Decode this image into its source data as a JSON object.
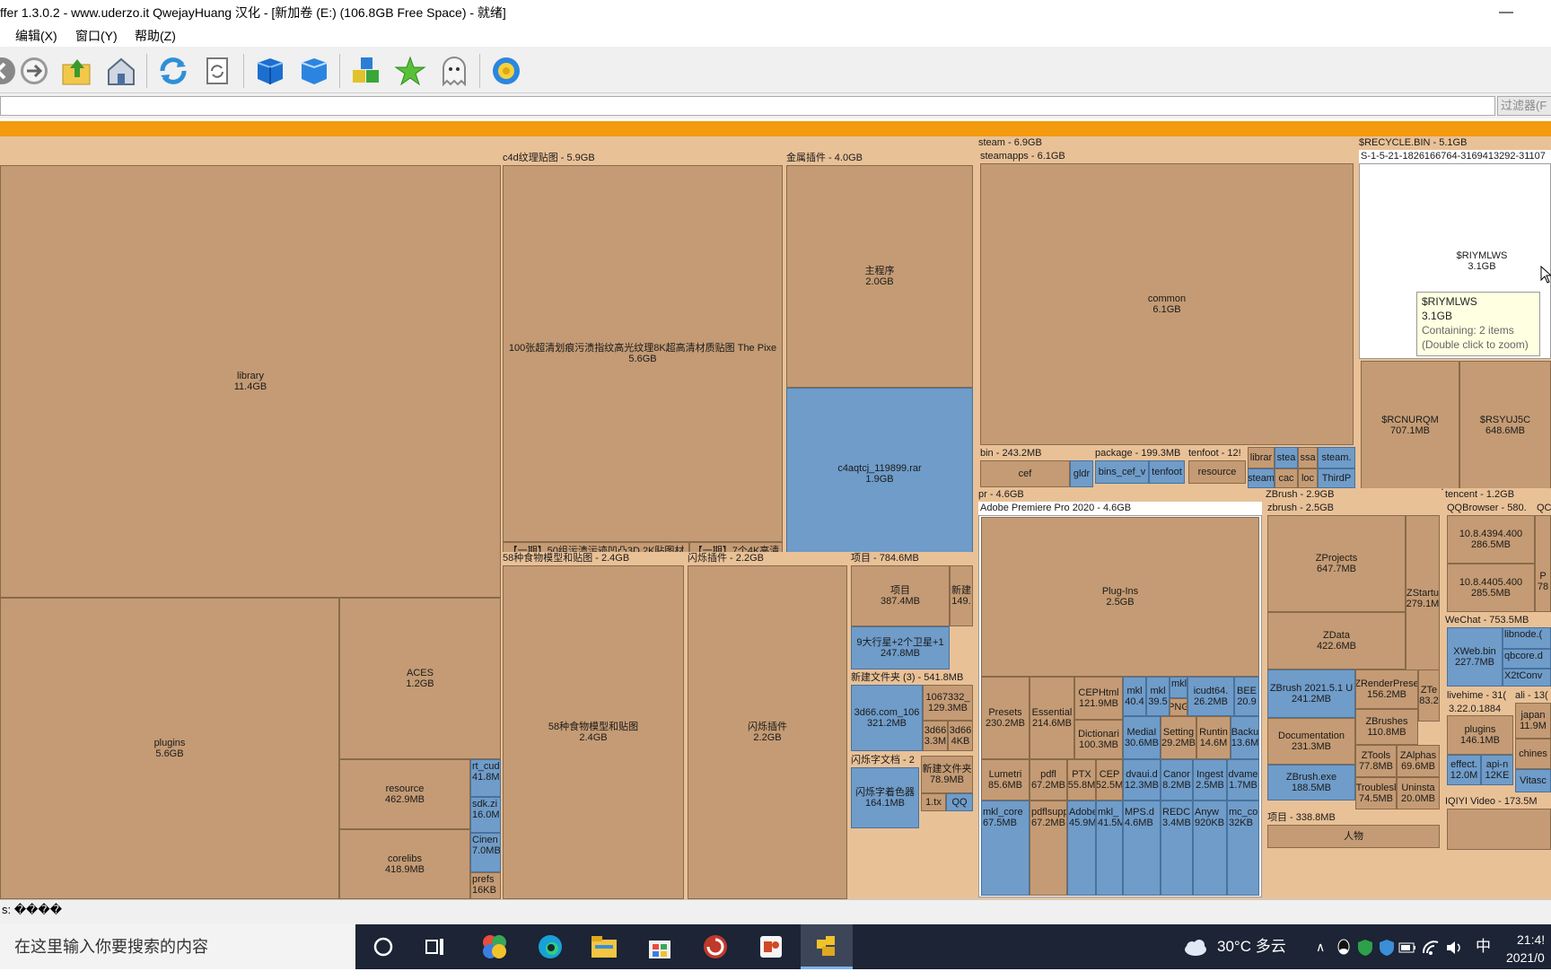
{
  "window": {
    "title": "ffer 1.3.0.2 - www.uderzo.it  QwejayHuang 汉化 - [新加卷 (E:) (106.8GB Free Space) - 就绪]",
    "minimize_glyph": "—"
  },
  "menu": {
    "edit": "编辑(X)",
    "window": "窗口(Y)",
    "help": "帮助(Z)"
  },
  "toolbar": {
    "icons": [
      "back-icon",
      "forward-icon",
      "folder-up-icon",
      "home-icon",
      "refresh-icon",
      "refresh-page-icon",
      "blue-cube-icon",
      "blue-cube-open-icon",
      "blocks-icon",
      "star-icon",
      "ghost-icon",
      "settings-gear-icon"
    ]
  },
  "filter": {
    "label": "过滤器(F"
  },
  "treemap": {
    "steam_header": "steam - 6.9GB",
    "recycle_header": "$RECYCLE.BIN - 5.1GB",
    "recycle_sid": "S-1-5-21-1826166764-3169413292-31107",
    "c4d_header": "c4d纹理贴图 - 5.9GB",
    "plugins_header": "金属插件 - 4.0GB",
    "steamapps_header": "steamapps - 6.1GB",
    "library": "library\n11.4GB",
    "plugins": "plugins\n5.6GB",
    "aces": "ACES\n1.2GB",
    "resource": "resource\n462.9MB",
    "corelibs": "corelibs\n418.9MB",
    "rt_cud": "rt_cud\n41.8M",
    "sdk": "sdk.zi\n16.0M",
    "cinema": "Cinen\n7.0MB",
    "prefs": "prefs\n16KB",
    "c4d_big": "100张超清划痕污渍指纹高光纹理8K超高清材质贴图 The Pixe\n5.6GB",
    "c4d_small1": "【一期】50组污渍污迹凹凸3D 2K贴图材",
    "c4d_small2": "【一期】7个4K高清",
    "main_program": "主程序\n2.0GB",
    "c4a_rar": "c4aqtcj_119899.rar\n1.9GB",
    "common": "common\n6.1GB",
    "bin_header": "bin - 243.2MB",
    "cef": "cef",
    "gldr": "gldr",
    "package_header": "package - 199.3MB",
    "bins_cef": "bins_cef_v",
    "tenfoot_inner": "tenfoot",
    "tenfoot_header": "tenfoot - 12!",
    "resource2": "resource",
    "libra": "librar",
    "stea": "stea",
    "ssa": "ssa",
    "steam_dot": "steam.",
    "steam2": "steam",
    "cac": "cac",
    "loc": "loc",
    "thirdp": "ThirdP",
    "riymlws": "$RIYMLWS\n3.1GB",
    "rcnurqm": "$RCNURQM\n707.1MB",
    "rsyujsc": "$RSYUJ5C\n648.6MB",
    "food_header": "58种食物模型和贴图 - 2.4GB",
    "food": "58种食物模型和贴图\n2.4GB",
    "flash_header": "闪烁插件 - 2.2GB",
    "flash": "闪烁插件\n2.2GB",
    "items_header": "项目 - 784.6MB",
    "items": "项目\n387.4MB",
    "items_new": "新建\n149.",
    "planets": "9大行星+2个卫星+1\n247.8MB",
    "newfolder_header": "新建文件夹 (3) - 541.8MB",
    "d66_big": "3d66.com_106\n321.2MB",
    "f1067": "1067332_\n129.3MB",
    "d66_a": "3d66\n3.3M",
    "d66_b": "3d66\n4KB",
    "flash_text_header": "闪烁字文档 - 2",
    "flash_color": "闪烁字着色器\n164.1MB",
    "newfolder2": "新建文件夹\n78.9MB",
    "txt1": "1.tx",
    "qq1": "QQ",
    "pr_header": "pr - 4.6GB",
    "premiere_header": "Adobe Premiere Pro 2020 - 4.6GB",
    "plugins_pr": "Plug-Ins\n2.5GB",
    "presets": "Presets\n230.2MB",
    "essential": "Essential\n214.6MB",
    "cephtml": "CEPHtml\n121.9MB",
    "dictionaries": "Dictionari\n100.3MB",
    "mkl1": "mkl\n40.4",
    "mkl2": "mkl\n39.5",
    "mkl3": "mkl_(",
    "icudt": "icudt64.\n26.2MB",
    "bee": "BEE\n20.9",
    "png": "PNG",
    "mediaio": "MediaI\n30.6MB",
    "settings": "Setting\n29.2MB",
    "runtime": "Runtin\n14.6M",
    "backup": "Backu\n13.6M",
    "lumetri": "Lumetri\n85.6MB",
    "pdfl": "pdfl\n67.2MB",
    "ptx": "PTX\n55.8M",
    "cep": "CEP\n52.5M",
    "dvaui": "dvaui.d\n12.3MB",
    "canon": "Canor\n8.2MB",
    "ingest": "Ingest\n2.5MB",
    "dvame": "dvame\n1.7MB",
    "mkl_core": "mkl_core\n67.5MB",
    "pdflsupp": "pdflsupp\n67.2MB",
    "adobe": "Adobe\n45.9M",
    "mkl4": "mkl_\n41.5M",
    "mpsd": "MPS.d\n4.6MB",
    "redc": "REDC\n3.4MB",
    "anyw": "Anyw\n920KB",
    "mccor": "mc_cor\n32KB",
    "zbrush_header": "ZBrush - 2.9GB",
    "zbrush_inner_header": "zbrush - 2.5GB",
    "zprojects": "ZProjects\n647.7MB",
    "zstartup": "ZStartu\n279.1M",
    "zdata": "ZData\n422.6MB",
    "zbrush2021": "ZBrush 2021.5.1 U\n241.2MB",
    "zrender": "ZRenderPrese\n156.2MB",
    "zte": "ZTe\n83.2",
    "documentation": "Documentation\n231.3MB",
    "zbrushes": "ZBrushes\n110.8MB",
    "ztools": "ZTools\n77.8MB",
    "zalphas": "ZAlphas\n69.6MB",
    "zbrush_exe": "ZBrush.exe\n188.5MB",
    "troubleshoot": "Troublesl\n74.5MB",
    "uninstall": "Uninsta\n20.0MB",
    "items2_header": "项目 - 338.8MB",
    "person": "人物",
    "tencent_header": "tencent - 1.2GB",
    "qqbrowser_header": "QQBrowser - 580.",
    "qq_header2": "QC",
    "v1": "10.8.4394.400\n286.5MB",
    "v2": "10.8.4405.400\n285.5MB",
    "p78": "P\n78",
    "wechat_header": "WeChat - 753.5MB",
    "xweb": "XWeb.bin\n227.7MB",
    "libnode": "libnode.(",
    "qbcore": "qbcore.d",
    "x2tconv": "X2tConv",
    "livehime_header": "livehime - 31(",
    "ali_header": "ali - 13(",
    "v3": "3.22.0.1884",
    "plugins_lh": "plugins\n146.1MB",
    "japan": "japan\n11.9M",
    "chine": "chines",
    "effect": "effect.\n12.0M",
    "apin": "api-n\n12KE",
    "vitasc": "Vitasc",
    "iqiyi_header": "IQIYI Video - 173.5M"
  },
  "tooltip": {
    "name": "$RIYMLWS",
    "size": "3.1GB",
    "contains": "Containing: 2 items",
    "hint": "(Double click to zoom)"
  },
  "status": {
    "text": "s: ����"
  },
  "taskbar": {
    "search_placeholder": "在这里输入你要搜索的内容",
    "weather": "30°C 多云",
    "ime": "中",
    "time": "21:4!",
    "date": "2021/0"
  }
}
